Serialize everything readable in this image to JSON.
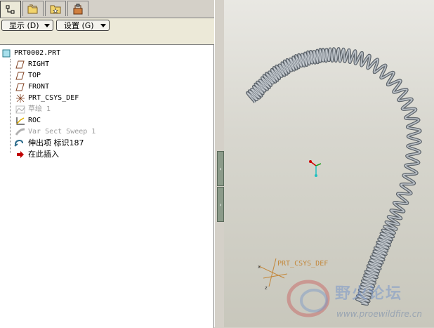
{
  "toolbar": {
    "display_label": "显示 (D)",
    "settings_label": "设置 (G)"
  },
  "tabs": [
    {
      "name": "model-tree-tab",
      "icon": "tree-icon"
    },
    {
      "name": "folder-browser-tab",
      "icon": "folder-icon"
    },
    {
      "name": "favorites-tab",
      "icon": "star-icon"
    },
    {
      "name": "connections-tab",
      "icon": "tools-icon"
    }
  ],
  "tree": {
    "root": "PRT0002.PRT",
    "items": [
      {
        "label": "RIGHT",
        "icon": "datum-plane-icon",
        "suppressed": false
      },
      {
        "label": "TOP",
        "icon": "datum-plane-icon",
        "suppressed": false
      },
      {
        "label": "FRONT",
        "icon": "datum-plane-icon",
        "suppressed": false
      },
      {
        "label": "PRT_CSYS_DEF",
        "icon": "coordinate-system-icon",
        "suppressed": false
      },
      {
        "label": "草绘 1",
        "icon": "sketch-icon",
        "suppressed": true
      },
      {
        "label": "ROC",
        "icon": "graph-icon",
        "suppressed": false
      },
      {
        "label": "Var Sect Sweep 1",
        "icon": "sweep-icon",
        "suppressed": true
      },
      {
        "label": "伸出项 标识187",
        "icon": "protrusion-icon",
        "suppressed": false
      },
      {
        "label": "在此插入",
        "icon": "insert-arrow-icon",
        "suppressed": false
      }
    ]
  },
  "viewport": {
    "csys_label": "PRT_CSYS_DEF",
    "watermark_text": "野火论坛",
    "watermark_url": "www.proewildfire.cn"
  },
  "colors": {
    "background_top": "#e9e8e3",
    "background_bottom": "#c8c7bc",
    "spring": "#8e959c",
    "csys": "#c3873a"
  }
}
